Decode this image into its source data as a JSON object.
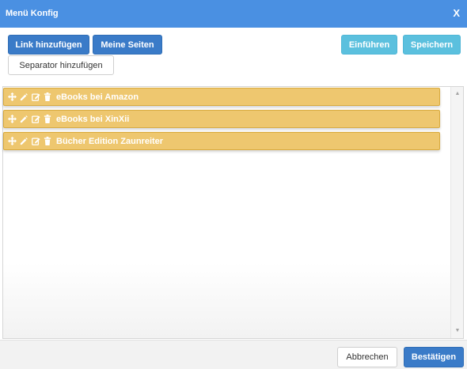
{
  "dialog": {
    "title": "Menü Konfig",
    "close_label": "X"
  },
  "toolbar": {
    "add_link": "Link hinzufügen",
    "my_pages": "Meine Seiten",
    "add_separator": "Separator hinzufügen",
    "import": "Einführen",
    "save": "Speichern"
  },
  "menu_items": [
    {
      "label": "eBooks bei Amazon"
    },
    {
      "label": "eBooks bei XinXii"
    },
    {
      "label": "Bücher Edition Zaunreiter"
    }
  ],
  "footer": {
    "cancel": "Abbrechen",
    "confirm": "Bestätigen"
  },
  "icons": [
    "move-icon",
    "pencil-icon",
    "edit-icon",
    "trash-icon",
    "scroll-up-icon",
    "scroll-down-icon"
  ],
  "colors": {
    "titlebar": "#4a90e2",
    "primary": "#3a7bc8",
    "info": "#5bc0de",
    "item_bg": "#eec76f",
    "item_border": "#d9ab3f"
  }
}
